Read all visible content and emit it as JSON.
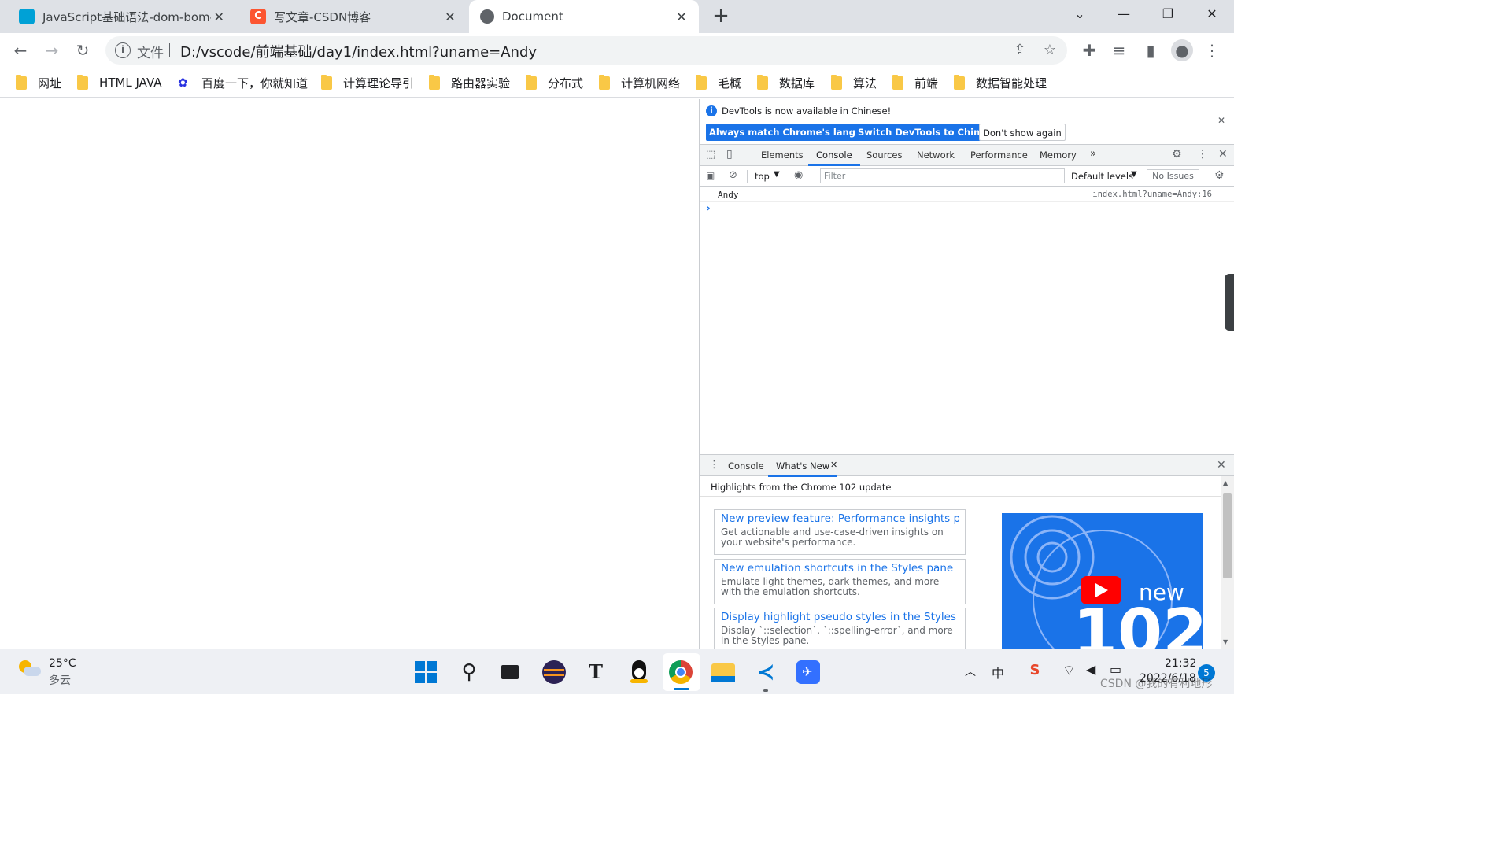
{
  "tabs": [
    {
      "title": "JavaScript基础语法-dom-bom-",
      "favicon": "bilibili-icon",
      "active": false
    },
    {
      "title": "写文章-CSDN博客",
      "favicon": "csdn-icon",
      "active": false
    },
    {
      "title": "Document",
      "favicon": "globe-icon",
      "active": true
    }
  ],
  "new_tab_label": "+",
  "address": {
    "scheme_label": "文件",
    "url": "D:/vscode/前端基础/day1/index.html?uname=Andy"
  },
  "bookmarks": [
    {
      "label": "网址",
      "icon": "folder-icon"
    },
    {
      "label": "HTML JAVA",
      "icon": "folder-icon"
    },
    {
      "label": "百度一下，你就知道",
      "icon": "baidu-icon"
    },
    {
      "label": "计算理论导引",
      "icon": "folder-icon"
    },
    {
      "label": "路由器实验",
      "icon": "folder-icon"
    },
    {
      "label": "分布式",
      "icon": "folder-icon"
    },
    {
      "label": "计算机网络",
      "icon": "folder-icon"
    },
    {
      "label": "毛概",
      "icon": "folder-icon"
    },
    {
      "label": "数据库",
      "icon": "folder-icon"
    },
    {
      "label": "算法",
      "icon": "folder-icon"
    },
    {
      "label": "前端",
      "icon": "folder-icon"
    },
    {
      "label": "数据智能处理",
      "icon": "folder-icon"
    }
  ],
  "devtools": {
    "infobar": {
      "message": "DevTools is now available in Chinese!",
      "btn_match": "Always match Chrome's language",
      "btn_switch": "Switch DevTools to Chinese",
      "btn_dont": "Don't show again"
    },
    "tabs": [
      "Elements",
      "Console",
      "Sources",
      "Network",
      "Performance",
      "Memory"
    ],
    "more_tabs": "»",
    "console_toolbar": {
      "context": "top",
      "filter_placeholder": "Filter",
      "levels": "Default levels",
      "issues": "No Issues"
    },
    "log": {
      "message": "Andy",
      "source": "index.html?uname=Andy:16"
    },
    "prompt": "›",
    "drawer": {
      "tabs": [
        "Console",
        "What's New"
      ],
      "highlights": "Highlights from the Chrome 102 update",
      "cards": [
        {
          "title": "New preview feature: Performance insights panel",
          "desc": "Get actionable and use-case-driven insights on your website's performance."
        },
        {
          "title": "New emulation shortcuts in the Styles pane",
          "desc": "Emulate light themes, dark themes, and more with the emulation shortcuts."
        },
        {
          "title": "Display highlight pseudo styles in the Styles pane",
          "desc": "Display `::selection`, `::spelling-error`, and more in the Styles pane."
        }
      ],
      "video": {
        "label": "new",
        "version": "102"
      }
    }
  },
  "taskbar": {
    "weather": {
      "temp": "25°C",
      "desc": "多云"
    },
    "apps": [
      "windows-start-icon",
      "search-icon",
      "task-view-icon",
      "eclipse-icon",
      "typora-icon",
      "qq-icon",
      "chrome-icon",
      "file-explorer-icon",
      "vscode-icon",
      "feishu-icon"
    ],
    "ime": "中",
    "clock": {
      "time": "21:32",
      "date": "2022/6/18"
    },
    "notifications": "5",
    "watermark": "CSDN @我的有利地形"
  },
  "colors": {
    "accent": "#1a73e8",
    "tabstrip": "#dee1e6",
    "chrome_bg": "#f1f3f4"
  }
}
